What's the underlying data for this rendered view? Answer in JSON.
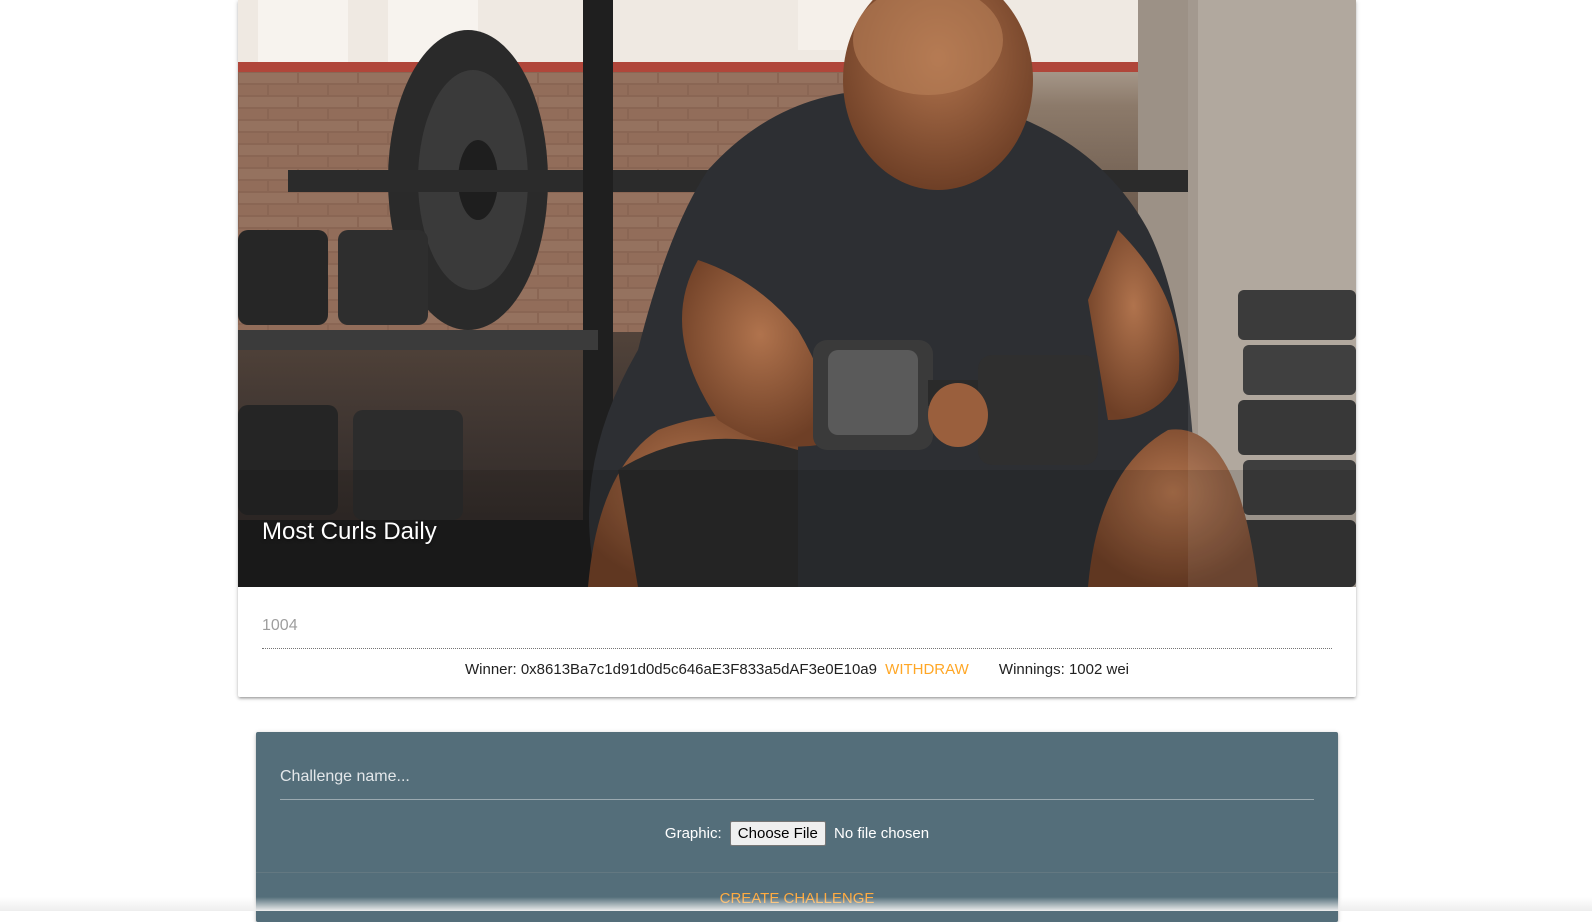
{
  "challenge_card": {
    "title": "Most Curls Daily",
    "value": "1004",
    "winner_label": "Winner:",
    "winner_address": "0x8613Ba7c1d91d0d5c646aE3F833a5dAF3e0E10a9",
    "withdraw_label": "WITHDRAW",
    "winnings_text": "Winnings: 1002 wei"
  },
  "create_form": {
    "name_placeholder": "Challenge name...",
    "graphic_label": "Graphic:",
    "choose_file_label": "Choose File",
    "no_file_text": "No file chosen",
    "create_label": "CREATE CHALLENGE"
  },
  "colors": {
    "accent": "#ffa726",
    "form_background": "#546e7a"
  }
}
